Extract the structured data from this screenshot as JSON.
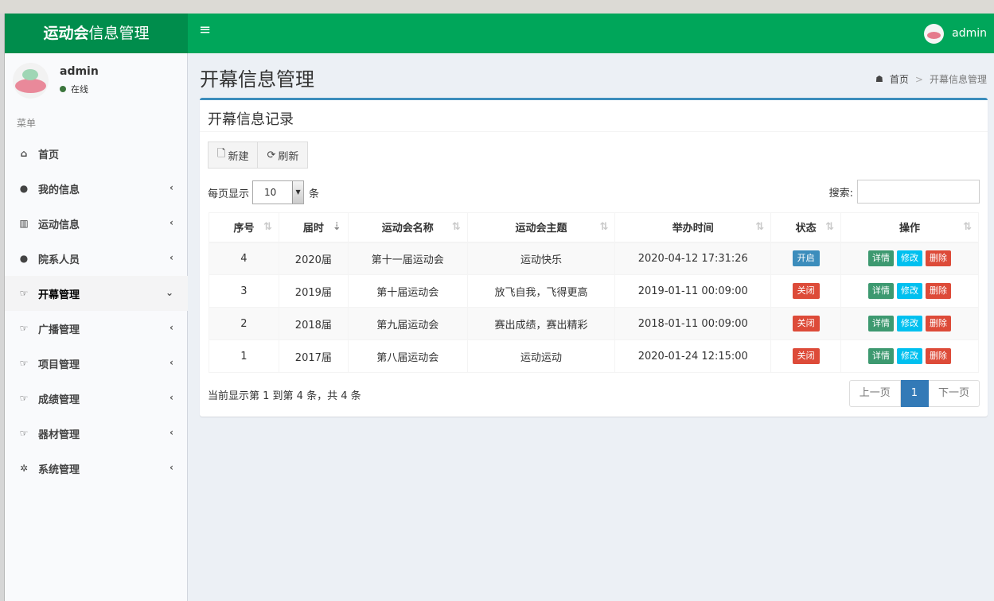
{
  "header": {
    "logo_bold": "运动会",
    "logo_rest": "信息管理",
    "menu_toggle_icon": "≡",
    "user": "admin"
  },
  "sidebar": {
    "user_name": "admin",
    "user_status": "在线",
    "menu_header": "菜单",
    "items": [
      {
        "label": "首页",
        "icon": "home-icon",
        "glyph": "⌂",
        "has_chevron": false,
        "active": false
      },
      {
        "label": "我的信息",
        "icon": "user-icon",
        "glyph": "●",
        "has_chevron": true,
        "active": false
      },
      {
        "label": "运动信息",
        "icon": "bar-chart-icon",
        "glyph": "▥",
        "has_chevron": true,
        "active": false
      },
      {
        "label": "院系人员",
        "icon": "users-icon",
        "glyph": "●",
        "has_chevron": true,
        "active": false
      },
      {
        "label": "开幕管理",
        "icon": "hand-point-icon",
        "glyph": "☞",
        "has_chevron": true,
        "active": true
      },
      {
        "label": "广播管理",
        "icon": "hand-point-icon",
        "glyph": "☞",
        "has_chevron": true,
        "active": false
      },
      {
        "label": "项目管理",
        "icon": "hand-point-icon",
        "glyph": "☞",
        "has_chevron": true,
        "active": false
      },
      {
        "label": "成绩管理",
        "icon": "hand-point-icon",
        "glyph": "☞",
        "has_chevron": true,
        "active": false
      },
      {
        "label": "器材管理",
        "icon": "hand-point-icon",
        "glyph": "☞",
        "has_chevron": true,
        "active": false
      },
      {
        "label": "系统管理",
        "icon": "gear-icon",
        "glyph": "✲",
        "has_chevron": true,
        "active": false
      }
    ]
  },
  "content": {
    "page_title": "开幕信息管理",
    "breadcrumb_home": "首页",
    "breadcrumb_current": "开幕信息管理",
    "box_title": "开幕信息记录",
    "btn_new": "新建",
    "btn_refresh": "刷新",
    "length_prefix": "每页显示",
    "length_value": "10",
    "length_suffix": "条",
    "search_label": "搜索:",
    "search_value": ""
  },
  "table": {
    "columns": [
      "序号",
      "届时",
      "运动会名称",
      "运动会主题",
      "举办时间",
      "状态",
      "操作"
    ],
    "rows": [
      {
        "id": "4",
        "session": "2020届",
        "name": "第十一届运动会",
        "theme": "运动快乐",
        "time": "2020-04-12 17:31:26",
        "status": "开启",
        "status_type": "open"
      },
      {
        "id": "3",
        "session": "2019届",
        "name": "第十届运动会",
        "theme": "放飞自我，飞得更高",
        "time": "2019-01-11 00:09:00",
        "status": "关闭",
        "status_type": "closed"
      },
      {
        "id": "2",
        "session": "2018届",
        "name": "第九届运动会",
        "theme": "赛出成绩，赛出精彩",
        "time": "2018-01-11 00:09:00",
        "status": "关闭",
        "status_type": "closed"
      },
      {
        "id": "1",
        "session": "2017届",
        "name": "第八届运动会",
        "theme": "运动运动",
        "time": "2020-01-24 12:15:00",
        "status": "关闭",
        "status_type": "closed"
      }
    ],
    "op_detail": "详情",
    "op_edit": "修改",
    "op_delete": "删除"
  },
  "footer": {
    "info": "当前显示第 1 到第 4 条，共 4 条",
    "prev": "上一页",
    "page": "1",
    "next": "下一页"
  },
  "colors": {
    "header": "#00a65a",
    "logo_bg": "#008d4c",
    "box_border": "#3c8dbc",
    "status_open": "#3c8dbc",
    "status_closed": "#dd4b39",
    "op_detail": "#3d9970",
    "op_edit": "#00c0ef",
    "op_delete": "#dd4b39"
  }
}
